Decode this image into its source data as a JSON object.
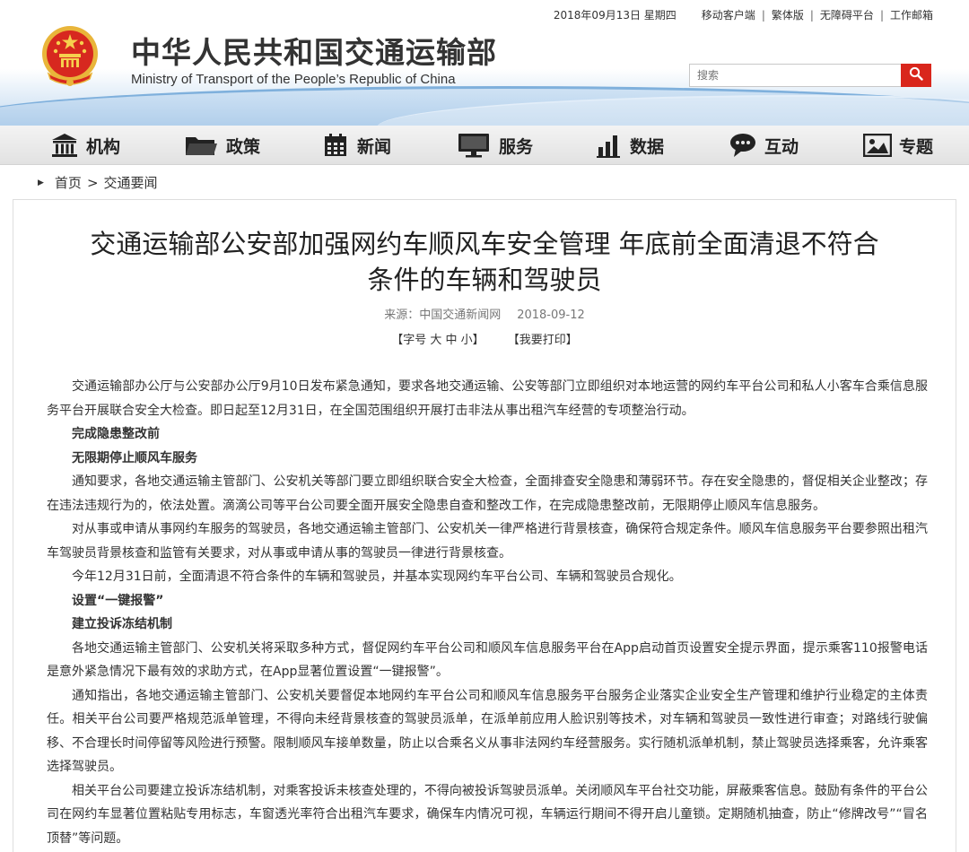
{
  "header": {
    "title_cn": "中华人民共和国交通运输部",
    "title_en": "Ministry of Transport of the People’s Republic of China",
    "date": "2018年09月13日 星期四",
    "links": [
      "移动客户端",
      "繁体版",
      "无障碍平台",
      "工作邮箱"
    ],
    "search_placeholder": "搜索",
    "accent_color": "#d9261c"
  },
  "nav": [
    {
      "label": "机构",
      "icon": "institution-icon"
    },
    {
      "label": "政策",
      "icon": "folder-icon"
    },
    {
      "label": "新闻",
      "icon": "calendar-icon"
    },
    {
      "label": "服务",
      "icon": "monitor-icon"
    },
    {
      "label": "数据",
      "icon": "bar-chart-icon"
    },
    {
      "label": "互动",
      "icon": "chat-icon"
    },
    {
      "label": "专题",
      "icon": "image-icon"
    }
  ],
  "breadcrumb": {
    "home": "首页",
    "separator": ">",
    "current": "交通要闻"
  },
  "article": {
    "title_line1": "交通运输部公安部加强网约车顺风车安全管理 年底前全面清退不符合",
    "title_line2": "条件的车辆和驾驶员",
    "source": "来源：中国交通新闻网",
    "date": "2018-09-12",
    "font_size_tool": "【字号 大 中 小】",
    "print_tool": "【我要打印】",
    "paragraphs": [
      {
        "type": "text",
        "text": "交通运输部办公厅与公安部办公厅9月10日发布紧急通知，要求各地交通运输、公安等部门立即组织对本地运营的网约车平台公司和私人小客车合乘信息服务平台开展联合安全大检查。即日起至12月31日，在全国范围组织开展打击非法从事出租汽车经营的专项整治行动。"
      },
      {
        "type": "sub",
        "text": "完成隐患整改前"
      },
      {
        "type": "sub",
        "text": "无限期停止顺风车服务"
      },
      {
        "type": "text",
        "text": "通知要求，各地交通运输主管部门、公安机关等部门要立即组织联合安全大检查，全面排查安全隐患和薄弱环节。存在安全隐患的，督促相关企业整改；存在违法违规行为的，依法处置。滴滴公司等平台公司要全面开展安全隐患自查和整改工作，在完成隐患整改前，无限期停止顺风车信息服务。"
      },
      {
        "type": "text",
        "text": "对从事或申请从事网约车服务的驾驶员，各地交通运输主管部门、公安机关一律严格进行背景核查，确保符合规定条件。顺风车信息服务平台要参照出租汽车驾驶员背景核查和监管有关要求，对从事或申请从事的驾驶员一律进行背景核查。"
      },
      {
        "type": "text",
        "text": "今年12月31日前，全面清退不符合条件的车辆和驾驶员，并基本实现网约车平台公司、车辆和驾驶员合规化。"
      },
      {
        "type": "sub",
        "text": "设置“一键报警”"
      },
      {
        "type": "sub",
        "text": "建立投诉冻结机制"
      },
      {
        "type": "text",
        "text": "各地交通运输主管部门、公安机关将采取多种方式，督促网约车平台公司和顺风车信息服务平台在App启动首页设置安全提示界面，提示乘客110报警电话是意外紧急情况下最有效的求助方式，在App显著位置设置“一键报警”。"
      },
      {
        "type": "text",
        "text": "通知指出，各地交通运输主管部门、公安机关要督促本地网约车平台公司和顺风车信息服务平台服务企业落实企业安全生产管理和维护行业稳定的主体责任。相关平台公司要严格规范派单管理，不得向未经背景核查的驾驶员派单，在派单前应用人脸识别等技术，对车辆和驾驶员一致性进行审查；对路线行驶偏移、不合理长时间停留等风险进行预警。限制顺风车接单数量，防止以合乘名义从事非法网约车经营服务。实行随机派单机制，禁止驾驶员选择乘客，允许乘客选择驾驶员。"
      },
      {
        "type": "text",
        "text": "相关平台公司要建立投诉冻结机制，对乘客投诉未核查处理的，不得向被投诉驾驶员派单。关闭顺风车平台社交功能，屏蔽乘客信息。鼓励有条件的平台公司在网约车显著位置粘贴专用标志，车窗透光率符合出租汽车要求，确保车内情况可视，车辆运行期间不得开启儿童锁。定期随机抽查，防止“修牌改号”“冒名顶替”等问题。"
      }
    ]
  }
}
